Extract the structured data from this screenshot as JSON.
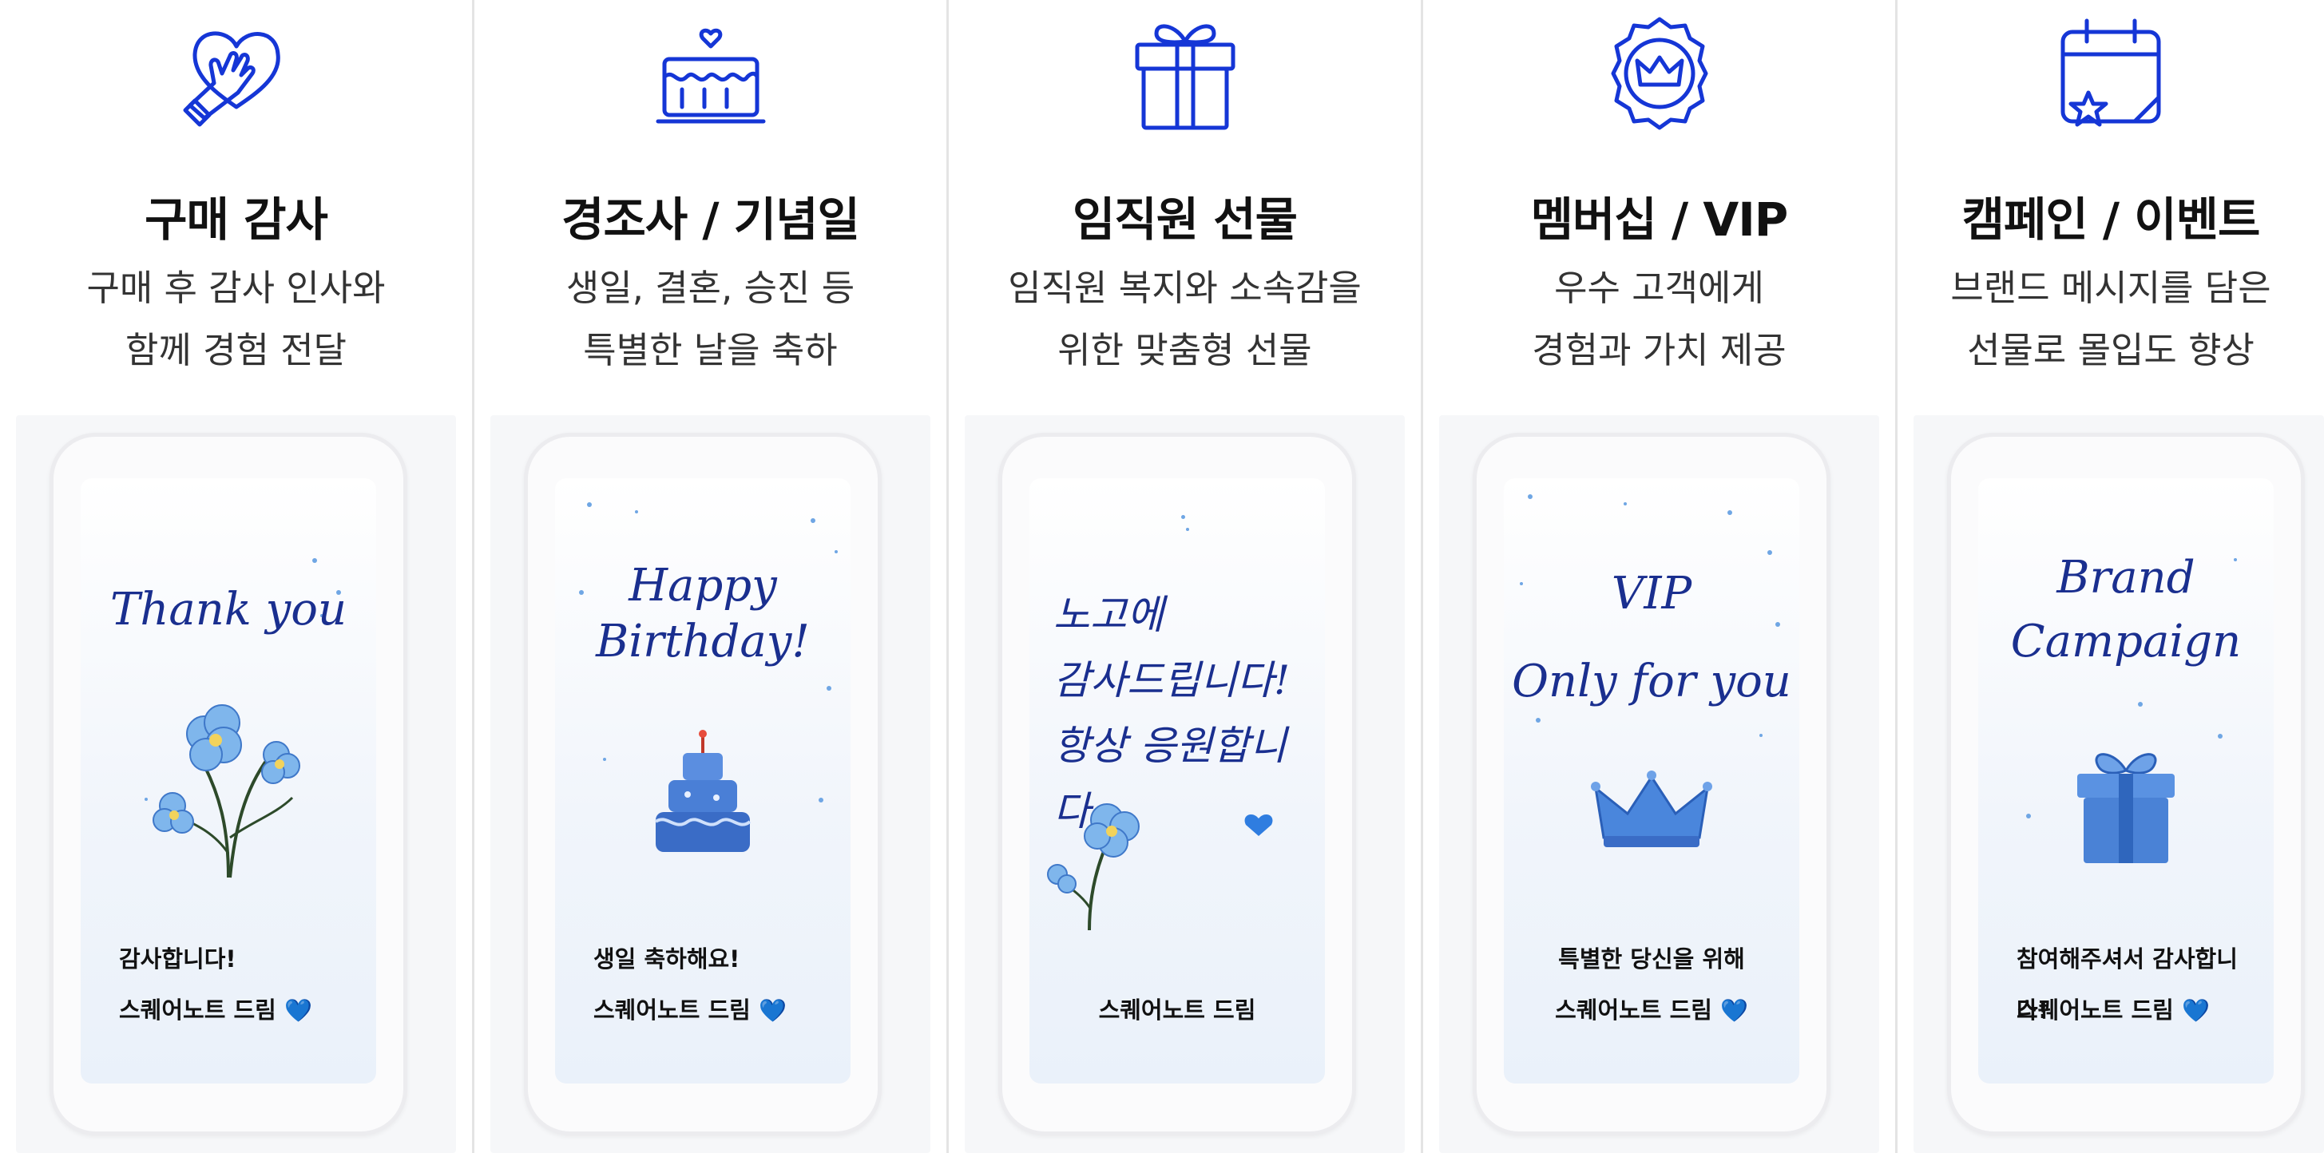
{
  "accent_color": "#1536d6",
  "columns": [
    {
      "icon": "heart-hand-icon",
      "title": "구매 감사",
      "desc": [
        "구매 후 감사 인사와",
        "함께 경험 전달"
      ],
      "card_script": [
        "Thank you"
      ],
      "card_art": "flower-illustration",
      "card_message": "감사합니다!",
      "card_sender": "스퀘어노트 드림",
      "card_heart": "💙"
    },
    {
      "icon": "cake-icon",
      "title": "경조사 / 기념일",
      "desc": [
        "생일, 결혼, 승진 등",
        "특별한 날을 축하"
      ],
      "card_script": [
        "Happy",
        "Birthday!"
      ],
      "card_art": "cake-illustration",
      "card_message": "생일 축하해요!",
      "card_sender": "스퀘어노트 드림",
      "card_heart": "💙"
    },
    {
      "icon": "gift-icon",
      "title": "임직원 선물",
      "desc": [
        "임직원 복지와 소속감을",
        "위한 맞춤형 선물"
      ],
      "card_script": [
        "노고에",
        "감사드립니다!",
        "항상 응원합니다."
      ],
      "card_art": "flower-illustration",
      "card_message": "",
      "card_sender": "스퀘어노트 드림",
      "card_heart": "💙"
    },
    {
      "icon": "crown-badge-icon",
      "title": "멤버십 / VIP",
      "desc": [
        "우수 고객에게",
        "경험과 가치 제공"
      ],
      "card_script": [
        "VIP",
        "Only for you"
      ],
      "card_art": "crown-illustration",
      "card_message": "특별한 당신을 위해",
      "card_sender": "스퀘어노트 드림",
      "card_heart": "💙"
    },
    {
      "icon": "calendar-star-icon",
      "title": "캠페인 / 이벤트",
      "desc": [
        "브랜드 메시지를 담은",
        "선물로 몰입도 향상"
      ],
      "card_script": [
        "Brand",
        "Campaign"
      ],
      "card_art": "gift-illustration",
      "card_message": "참여해주셔서 감사합니다!",
      "card_sender": "스퀘어노트 드림",
      "card_heart": "💙"
    }
  ]
}
